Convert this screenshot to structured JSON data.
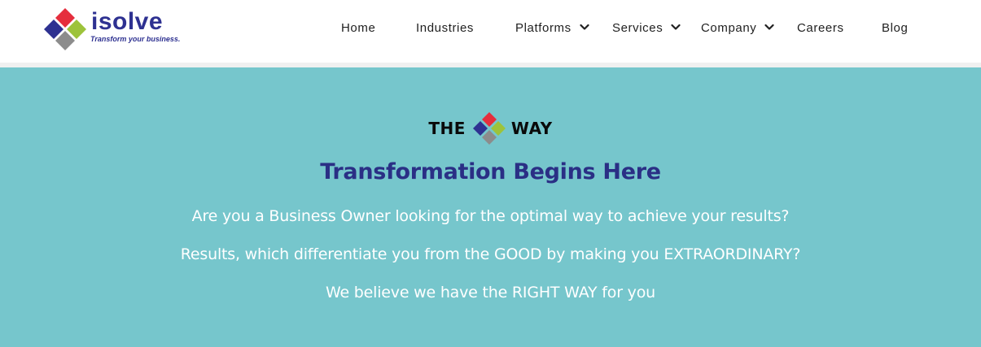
{
  "logo": {
    "word": "isolve",
    "tagline": "Transform your business.",
    "colors": {
      "red": "#e52e3d",
      "green": "#9dc33b",
      "navy": "#2e3191",
      "gray": "#8c8c8c"
    }
  },
  "nav": {
    "items": [
      {
        "label": "Home",
        "has_dropdown": false
      },
      {
        "label": "Industries",
        "has_dropdown": false
      },
      {
        "label": "Platforms",
        "has_dropdown": true
      },
      {
        "label": "Services",
        "has_dropdown": true
      },
      {
        "label": "Company",
        "has_dropdown": true
      },
      {
        "label": "Careers",
        "has_dropdown": false
      },
      {
        "label": "Blog",
        "has_dropdown": false
      }
    ]
  },
  "hero": {
    "background": "#76c6cc",
    "the_word": "THE",
    "way_word": "WAY",
    "headline": "Transformation Begins Here",
    "headline_color": "#2a2f85",
    "lines": [
      "Are you a Business Owner looking for the optimal way to achieve your results?",
      "Results, which differentiate you from the GOOD by making you EXTRAORDINARY?",
      "We believe we have the RIGHT WAY for you"
    ]
  },
  "icons": [
    "isolve-diamond-logo",
    "chevron-down-icon"
  ]
}
